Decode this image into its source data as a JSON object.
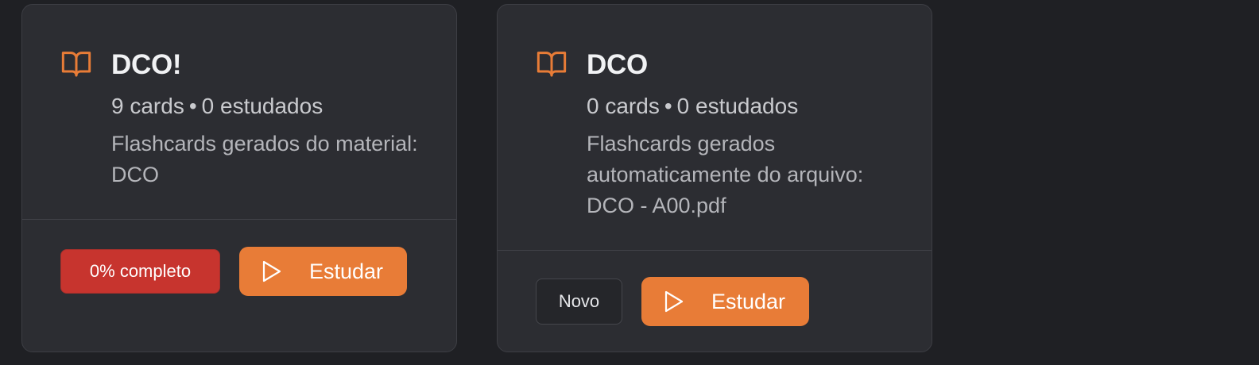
{
  "decks": [
    {
      "title": "DCO!",
      "cards_count": "9 cards",
      "separator": "•",
      "studied_count": "0 estudados",
      "description": "Flashcards gerados do material: DCO",
      "status_label": "0% completo",
      "status_kind": "progress",
      "progress_fraction": 0,
      "study_label": "Estudar"
    },
    {
      "title": "DCO",
      "cards_count": "0 cards",
      "separator": "•",
      "studied_count": "0 estudados",
      "description": "Flashcards gerados automaticamente do arquivo: DCO - A00.pdf",
      "status_label": "Novo",
      "status_kind": "new",
      "study_label": "Estudar"
    }
  ],
  "icons": {
    "deck": "book-open-icon",
    "study": "play-icon"
  },
  "colors": {
    "background": "#1f2024",
    "card": "#2c2d32",
    "accent": "#e87c37",
    "progress_badge": "#c7342e"
  }
}
